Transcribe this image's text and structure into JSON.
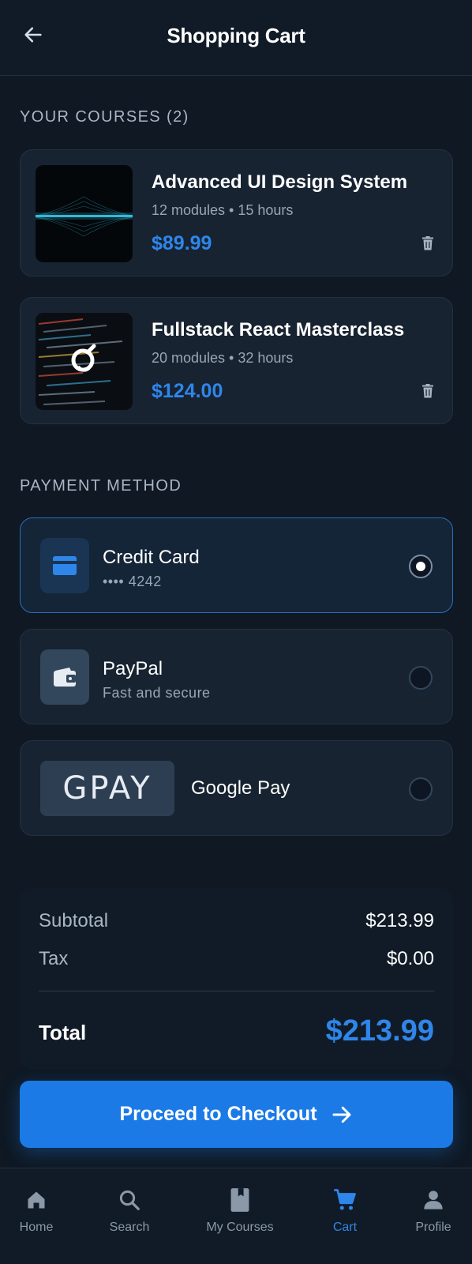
{
  "header": {
    "title": "Shopping Cart",
    "back_icon": "arrow-left-icon"
  },
  "courses_section": {
    "label": "YOUR COURSES (2)"
  },
  "courses": [
    {
      "title": "Advanced UI Design System",
      "meta": "12 modules • 15 hours",
      "price": "$89.99"
    },
    {
      "title": "Fullstack React Masterclass",
      "meta": "20 modules • 32 hours",
      "price": "$124.00"
    }
  ],
  "payment_section": {
    "label": "PAYMENT METHOD"
  },
  "payment_methods": [
    {
      "name": "Credit Card",
      "sub": "•••• 4242",
      "selected": true,
      "icon": "credit-card-icon"
    },
    {
      "name": "PayPal",
      "sub": "Fast and secure",
      "selected": false,
      "icon": "wallet-icon"
    },
    {
      "name": "Google Pay",
      "logo_text": "GPAY",
      "selected": false
    }
  ],
  "summary": {
    "subtotal_label": "Subtotal",
    "subtotal_value": "$213.99",
    "tax_label": "Tax",
    "tax_value": "$0.00",
    "total_label": "Total",
    "total_value": "$213.99"
  },
  "checkout": {
    "label": "Proceed to Checkout"
  },
  "nav": [
    {
      "label": "Home",
      "icon": "home-icon"
    },
    {
      "label": "Search",
      "icon": "search-icon"
    },
    {
      "label": "My Courses",
      "icon": "book-icon"
    },
    {
      "label": "Cart",
      "icon": "cart-icon",
      "active": true
    },
    {
      "label": "Profile",
      "icon": "profile-icon"
    }
  ],
  "colors": {
    "accent": "#2f86ea",
    "button": "#1b7ae6",
    "background": "#0f1823",
    "card": "#172331"
  }
}
